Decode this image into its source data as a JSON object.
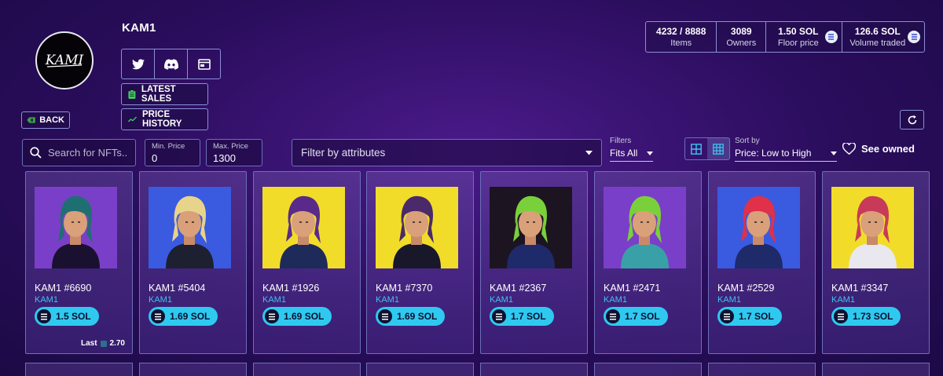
{
  "collection": {
    "title": "KAM1",
    "logo_text": "KAMI"
  },
  "socials": [
    {
      "icon": "twitter-icon"
    },
    {
      "icon": "discord-icon"
    },
    {
      "icon": "website-icon"
    }
  ],
  "buttons": {
    "latest_sales": "LATEST SALES",
    "price_history": "PRICE HISTORY",
    "back": "BACK"
  },
  "stats": [
    {
      "value": "4232 / 8888",
      "label": "Items",
      "sol": false
    },
    {
      "value": "3089",
      "label": "Owners",
      "sol": false
    },
    {
      "value": "1.50 SOL",
      "label": "Floor price",
      "sol": true
    },
    {
      "value": "126.6 SOL",
      "label": "Volume traded",
      "sol": true
    }
  ],
  "search": {
    "placeholder": "Search for NFTs.."
  },
  "min_price": {
    "label": "Min. Price",
    "value": "0"
  },
  "max_price": {
    "label": "Max. Price",
    "value": "1300"
  },
  "attributes": {
    "placeholder": "Filter by attributes"
  },
  "filters": {
    "label": "Filters",
    "value": "Fits All"
  },
  "sort": {
    "label": "Sort by",
    "value": "Price: Low to High"
  },
  "see_owned": "See owned",
  "cards": [
    {
      "name": "KAM1 #6690",
      "collection": "KAM1",
      "price": "1.5 SOL",
      "bg": "#7a3fc8",
      "hair": "#1f6f72",
      "shirt": "#1a1030",
      "last": "Last",
      "last_value": "2.70"
    },
    {
      "name": "KAM1 #5404",
      "collection": "KAM1",
      "price": "1.69 SOL",
      "bg": "#3a5ae0",
      "hair": "#e8d38a",
      "shirt": "#1c2030"
    },
    {
      "name": "KAM1 #1926",
      "collection": "KAM1",
      "price": "1.69 SOL",
      "bg": "#f2dc2a",
      "hair": "#5a2a8a",
      "shirt": "#1e2a5a"
    },
    {
      "name": "KAM1 #7370",
      "collection": "KAM1",
      "price": "1.69 SOL",
      "bg": "#f2dc2a",
      "hair": "#4a2a6a",
      "shirt": "#18182a"
    },
    {
      "name": "KAM1 #2367",
      "collection": "KAM1",
      "price": "1.7 SOL",
      "bg": "#1c1420",
      "hair": "#7ad03a",
      "shirt": "#1e2a6a"
    },
    {
      "name": "KAM1 #2471",
      "collection": "KAM1",
      "price": "1.7 SOL",
      "bg": "#7a3fc8",
      "hair": "#7ad03a",
      "shirt": "#3aa0a8"
    },
    {
      "name": "KAM1 #2529",
      "collection": "KAM1",
      "price": "1.7 SOL",
      "bg": "#3a5ae0",
      "hair": "#e0304a",
      "shirt": "#1e2a6a"
    },
    {
      "name": "KAM1 #3347",
      "collection": "KAM1",
      "price": "1.73 SOL",
      "bg": "#f2dc2a",
      "hair": "#c83a5a",
      "shirt": "#e8e8ee"
    }
  ]
}
